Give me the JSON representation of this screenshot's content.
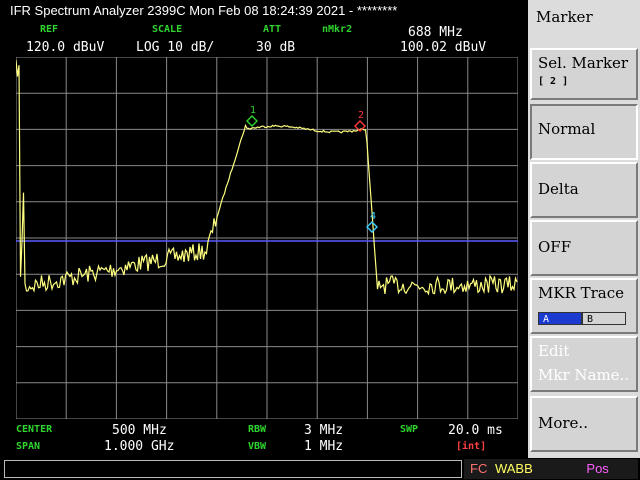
{
  "title": "IFR Spectrum Analyzer 2399C Mon Feb 08 18:24:39 2021 - ********",
  "header": {
    "ref_label": "REF",
    "ref_value": "120.0 dBuV",
    "scale_label": "SCALE",
    "scale_value": "LOG 10 dB/",
    "att_label": "ATT",
    "att_value": "30 dB",
    "marker_label": "nMkr2",
    "marker_freq": "688 MHz",
    "marker_level": "100.02 dBuV"
  },
  "footer": {
    "center_label": "CENTER",
    "center_value": "500 MHz",
    "span_label": "SPAN",
    "span_value": "1.000 GHz",
    "rbw_label": "RBW",
    "rbw_value": "3 MHz",
    "vbw_label": "VBW",
    "vbw_value": "1 MHz",
    "swp_label": "SWP",
    "swp_value": "20.0 ms",
    "swp_mode": "[int]"
  },
  "markers": [
    {
      "id": "1",
      "color": "#2fd42f"
    },
    {
      "id": "2",
      "color": "#ff3a3a"
    },
    {
      "id": "4",
      "color": "#40d0ff"
    }
  ],
  "softkeys": {
    "header": "Marker",
    "sel_marker": "Sel. Marker",
    "sel_marker_sub": "[ 2 ]",
    "normal": "Normal",
    "delta": "Delta",
    "off": "OFF",
    "mkr_trace": "MKR Trace",
    "trace_a": "A",
    "trace_b": "B",
    "edit": "Edit",
    "mkr_name": "Mkr Name..",
    "more": "More.."
  },
  "status": {
    "fc": "FC",
    "wabb": "WABB",
    "pos": "Pos"
  },
  "colors": {
    "trace": "#ffff80",
    "grid": "#8a8a8a",
    "display_line": "#5a5aff",
    "label_green": "#2fd42f",
    "swp_mode": "#ff4040"
  }
}
